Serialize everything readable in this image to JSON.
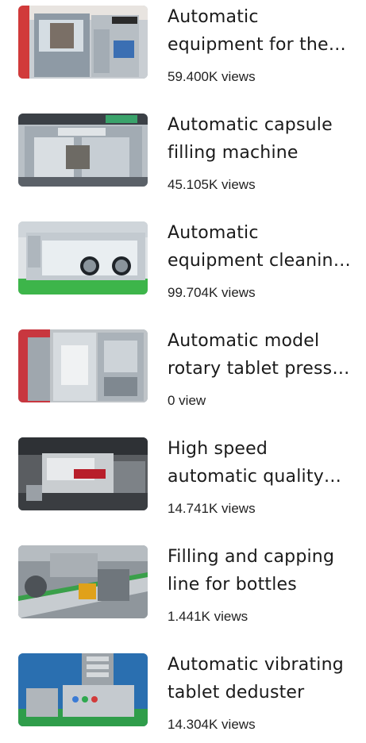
{
  "videos": [
    {
      "title": "Automatic equipment for the production of capsules",
      "views": "59.400K views",
      "thumb_icon": "capsule-filling-machine-thumbnail"
    },
    {
      "title": "Automatic capsule filling machine",
      "views": "45.105K views",
      "thumb_icon": "capsule-machine-exhibition-thumbnail"
    },
    {
      "title": "Automatic equipment cleaning isolator",
      "views": "99.704K views",
      "thumb_icon": "glovebox-isolator-thumbnail"
    },
    {
      "title": "Automatic model rotary tablet press machine",
      "views": "0 view",
      "thumb_icon": "rotary-tablet-press-thumbnail"
    },
    {
      "title": "High speed automatic quality inspection",
      "views": "14.741K views",
      "thumb_icon": "inspection-machine-thumbnail"
    },
    {
      "title": "Filling and capping line for bottles",
      "views": "1.441K views",
      "thumb_icon": "filling-capping-line-thumbnail"
    },
    {
      "title": "Automatic vibrating tablet deduster",
      "views": "14.304K views",
      "thumb_icon": "tablet-deduster-thumbnail"
    }
  ]
}
